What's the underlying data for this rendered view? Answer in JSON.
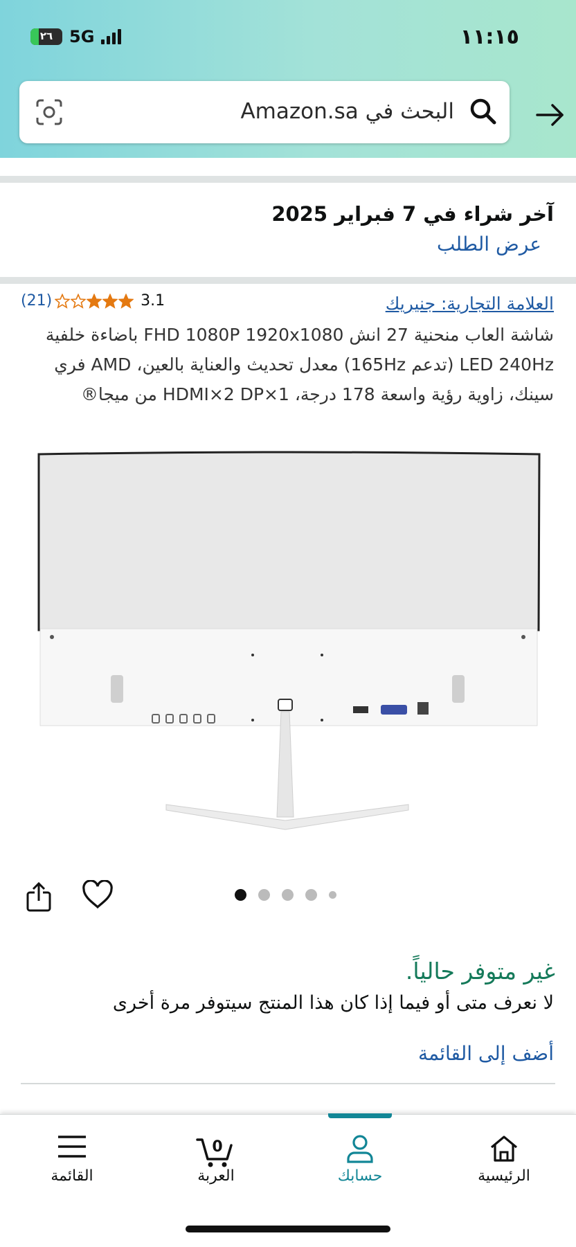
{
  "status_bar": {
    "time": "١١:١٥",
    "network": "5G",
    "battery_level": "٢٦",
    "battery_fraction": 0.26
  },
  "search": {
    "placeholder": "البحث في Amazon.sa"
  },
  "purchase": {
    "title": "آخر شراء في 7 فبراير 2025",
    "view_order": "عرض الطلب"
  },
  "product": {
    "brand": "العلامة التجارية: جنيريك",
    "rating_value": "3.1",
    "rating_stars": 3.1,
    "review_count": "(21)",
    "title": "شاشة العاب منحنية 27 انش FHD 1080P 1920x1080 باضاءة خلفية LED 240Hz (تدعم 165Hz) معدل تحديث والعناية بالعين، AMD فري سينك، زاوية رؤية واسعة 178 درجة، 1×HDMI×2 DP من ميجا®",
    "image_count": 5,
    "active_image": 1,
    "availability": "غير متوفر حالياً.",
    "availability_note": "لا نعرف متى أو فيما إذا كان هذا المنتج سيتوفر مرة أخرى",
    "add_to_list": "أضف إلى القائمة"
  },
  "bottom_nav": {
    "items": [
      {
        "label": "الرئيسية",
        "icon": "home-icon"
      },
      {
        "label": "حسابك",
        "icon": "account-icon",
        "active": true
      },
      {
        "label": "العربة",
        "icon": "cart-icon",
        "badge": "0"
      },
      {
        "label": "القائمة",
        "icon": "menu-icon"
      }
    ]
  },
  "colors": {
    "accent": "#128696",
    "link": "#1f5aa3",
    "availability": "#157a5a",
    "star": "#e47911"
  }
}
